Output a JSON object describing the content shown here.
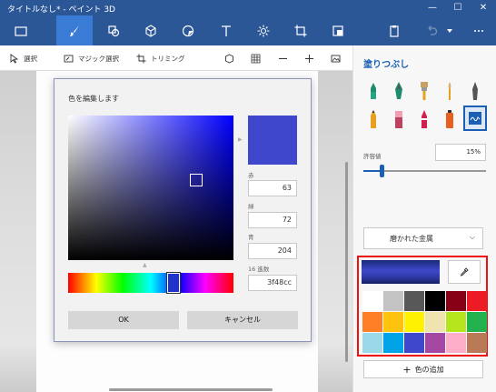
{
  "window": {
    "title": "タイトルなし* - ペイント 3D",
    "minimize": "—",
    "maximize": "☐",
    "close": "✕"
  },
  "toolbar": {
    "select": "選択",
    "magic_select": "マジック選択",
    "crop": "トリミング"
  },
  "dialog": {
    "title": "色を編集します",
    "red_label": "赤",
    "red_value": "63",
    "green_label": "緑",
    "green_value": "72",
    "blue_label": "青",
    "blue_value": "204",
    "hex_label": "16 進数",
    "hex_value": "3f48cc",
    "preview_color": "#3f48cc",
    "ok": "OK",
    "cancel": "キャンセル"
  },
  "panel": {
    "title": "塗りつぶし",
    "tolerance_label": "許容値",
    "tolerance_value": "15%",
    "tolerance_level": 0.15,
    "material": "磨かれた金属",
    "current_color": "#3f48cc",
    "add_color": "色の追加",
    "palette": [
      "#ffffff",
      "#c3c3c3",
      "#585858",
      "#000000",
      "#880015",
      "#ed1c24",
      "#ff7f27",
      "#ffc20e",
      "#fff200",
      "#efe4b0",
      "#b5e61d",
      "#22b14c",
      "#99d9ea",
      "#00a2e8",
      "#3f48cc",
      "#a349a4",
      "#ffaec9",
      "#b97a57"
    ]
  },
  "colors": {
    "chrome": "#2b5797",
    "accent": "#1a5fb4",
    "highlight_frame": "#ee1111"
  }
}
